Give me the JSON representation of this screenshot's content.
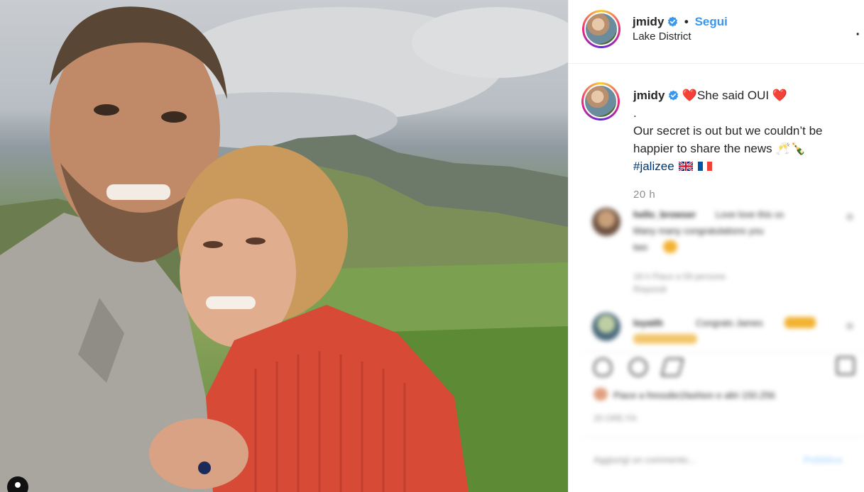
{
  "post": {
    "username": "jmidy",
    "follow_label": "Segui",
    "separator": "•",
    "location": "Lake District",
    "more_label": "..."
  },
  "caption": {
    "username": "jmidy",
    "heart": "❤️",
    "line1": "She said OUI",
    "line2": ".",
    "line3": "Our secret is out but we couldn’t be",
    "line4": "happier to share the news",
    "emoji_after": "🥂🍾",
    "hashtag": "#jalizee"
  },
  "time_ago": "20 h",
  "blurred": {
    "comment1_user": "hello_browser",
    "comment1_text": "Love love this xx",
    "comment1_line2": "Many many congratulations you",
    "comment1_line3": "two",
    "comment1_meta": "18 h   Piace a 59 persone",
    "comment1_reply": "Rispondi",
    "comment2_user": "loyaith",
    "comment2_text": "Congrats James",
    "likes_line": "Piace a fressdie1fashion e altri 150.256",
    "date_line": "20 ORE FA",
    "comment_placeholder": "Aggiungi un commento...",
    "publish_label": "Pubblica"
  },
  "colors": {
    "accent": "#3897f0",
    "verified": "#3897f0",
    "heart": "#e0245e",
    "hashtag": "#00376b",
    "muted": "#8e8e8e"
  }
}
